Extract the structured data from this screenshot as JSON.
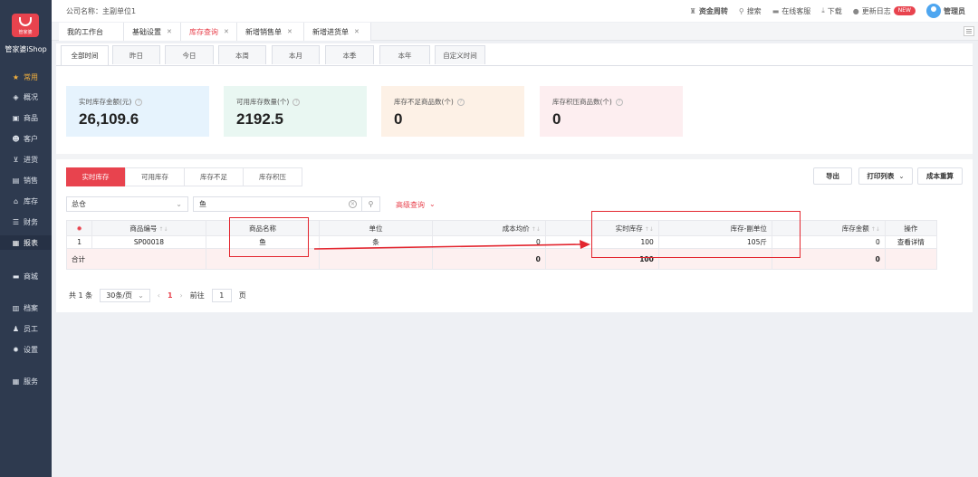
{
  "sidebar": {
    "logo_text": "管家婆",
    "app_name": "管家婆iShop",
    "items": [
      {
        "label": "常用",
        "icon": "star-icon"
      },
      {
        "label": "概况",
        "icon": "layers-icon"
      },
      {
        "label": "商品",
        "icon": "box-icon"
      },
      {
        "label": "客户",
        "icon": "users-icon"
      },
      {
        "label": "进货",
        "icon": "cart-icon"
      },
      {
        "label": "销售",
        "icon": "sale-icon"
      },
      {
        "label": "库存",
        "icon": "warehouse-icon"
      },
      {
        "label": "财务",
        "icon": "finance-icon"
      },
      {
        "label": "报表",
        "icon": "report-icon"
      },
      {
        "label": "商城",
        "icon": "store-icon"
      },
      {
        "label": "档案",
        "icon": "archive-icon"
      },
      {
        "label": "员工",
        "icon": "staff-icon"
      },
      {
        "label": "设置",
        "icon": "settings-icon"
      },
      {
        "label": "服务",
        "icon": "grid-icon"
      }
    ]
  },
  "topbar": {
    "company": "公司名称：主副单位1",
    "fund_transfer": "资金周转",
    "search": "搜索",
    "support": "在线客服",
    "download": "下载",
    "changelog": "更新日志",
    "new_badge": "NEW",
    "user": "管理员"
  },
  "page_tabs": [
    {
      "label": "我的工作台",
      "closable": false
    },
    {
      "label": "基础设置",
      "closable": true
    },
    {
      "label": "库存查询",
      "closable": true,
      "active": true
    },
    {
      "label": "新增销售单",
      "closable": true
    },
    {
      "label": "新增进货单",
      "closable": true
    }
  ],
  "time_tabs": [
    "全部时间",
    "昨日",
    "今日",
    "本周",
    "本月",
    "本季",
    "本年",
    "自定义时间"
  ],
  "stats": [
    {
      "label": "实时库存金额(元)",
      "value": "26,109.6",
      "color": "#e6f3fd"
    },
    {
      "label": "可用库存数量(个)",
      "value": "2192.5",
      "color": "#e9f7f2"
    },
    {
      "label": "库存不足商品数(个)",
      "value": "0",
      "color": "#fdf1e6"
    },
    {
      "label": "库存积压商品数(个)",
      "value": "0",
      "color": "#fdeef0"
    }
  ],
  "sub_tabs": [
    "实时库存",
    "可用库存",
    "库存不足",
    "库存积压"
  ],
  "actions": {
    "export": "导出",
    "print": "打印列表",
    "recalc": "成本重算"
  },
  "filters": {
    "warehouse": "总仓",
    "search_value": "鱼",
    "advanced": "高级查询"
  },
  "table": {
    "headers": [
      "商品编号",
      "商品名称",
      "单位",
      "成本均价",
      "实时库存",
      "库存-副单位",
      "库存金额",
      "操作"
    ],
    "rows": [
      {
        "idx": "1",
        "code": "SP00018",
        "name": "鱼",
        "unit": "条",
        "cost": "0",
        "stock": "100",
        "sub_unit": "105斤",
        "amount": "0",
        "action": "查看详情"
      }
    ],
    "total": {
      "label": "合计",
      "cost": "0",
      "stock": "100",
      "amount": "0"
    }
  },
  "pagination": {
    "total": "共 1 条",
    "page_size": "30条/页",
    "current": "1",
    "goto_label": "前往",
    "goto_value": "1",
    "page_suffix": "页"
  }
}
